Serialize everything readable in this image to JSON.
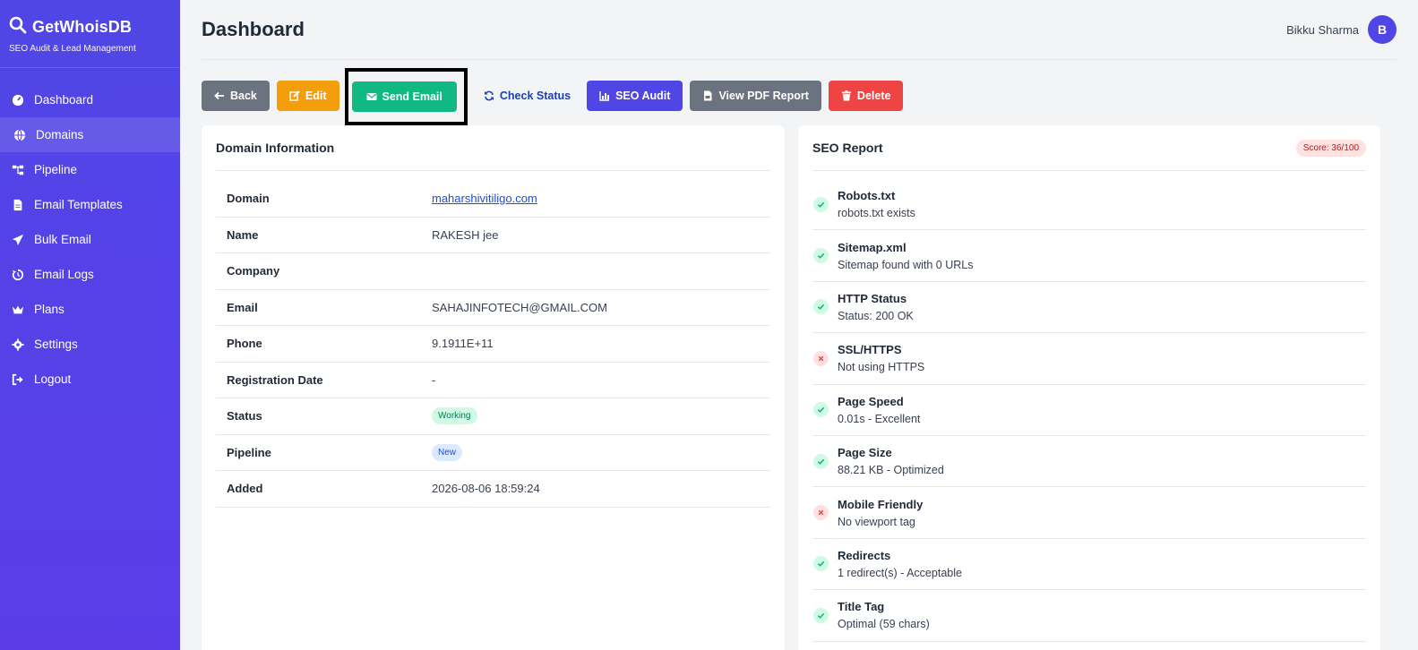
{
  "brand": {
    "name": "GetWhoisDB",
    "subtitle": "SEO Audit & Lead Management"
  },
  "sidebar": {
    "items": [
      {
        "label": "Dashboard",
        "icon": "dashboard-icon"
      },
      {
        "label": "Domains",
        "icon": "globe-icon",
        "active": true
      },
      {
        "label": "Pipeline",
        "icon": "sitemap-icon"
      },
      {
        "label": "Email Templates",
        "icon": "file-icon"
      },
      {
        "label": "Bulk Email",
        "icon": "paper-plane-icon"
      },
      {
        "label": "Email Logs",
        "icon": "history-icon"
      },
      {
        "label": "Plans",
        "icon": "crown-icon"
      },
      {
        "label": "Settings",
        "icon": "gear-icon"
      },
      {
        "label": "Logout",
        "icon": "logout-icon"
      }
    ]
  },
  "header": {
    "title": "Dashboard",
    "user_name": "Bikku Sharma",
    "avatar_initial": "B"
  },
  "toolbar": {
    "back": "Back",
    "edit": "Edit",
    "send_email": "Send Email",
    "check_status": "Check Status",
    "seo_audit": "SEO Audit",
    "view_pdf": "View PDF Report",
    "delete": "Delete"
  },
  "domain_info": {
    "title": "Domain Information",
    "rows": [
      {
        "label": "Domain",
        "value": "maharshivitiligo.com"
      },
      {
        "label": "Name",
        "value": "RAKESH jee"
      },
      {
        "label": "Company",
        "value": ""
      },
      {
        "label": "Email",
        "value": "SAHAJINFOTECH@GMAIL.COM"
      },
      {
        "label": "Phone",
        "value": "9.1911E+11"
      },
      {
        "label": "Registration Date",
        "value": "-"
      },
      {
        "label": "Status",
        "value": "Working"
      },
      {
        "label": "Pipeline",
        "value": "New"
      },
      {
        "label": "Added",
        "value": "2026-08-06 18:59:24"
      }
    ]
  },
  "seo_report": {
    "title": "SEO Report",
    "score": "Score: 36/100",
    "items": [
      {
        "title": "Robots.txt",
        "desc": "robots.txt exists",
        "status": "ok"
      },
      {
        "title": "Sitemap.xml",
        "desc": "Sitemap found with 0 URLs",
        "status": "ok"
      },
      {
        "title": "HTTP Status",
        "desc": "Status: 200 OK",
        "status": "ok"
      },
      {
        "title": "SSL/HTTPS",
        "desc": "Not using HTTPS",
        "status": "fail"
      },
      {
        "title": "Page Speed",
        "desc": "0.01s - Excellent",
        "status": "ok"
      },
      {
        "title": "Page Size",
        "desc": "88.21 KB - Optimized",
        "status": "ok"
      },
      {
        "title": "Mobile Friendly",
        "desc": "No viewport tag",
        "status": "fail"
      },
      {
        "title": "Redirects",
        "desc": "1 redirect(s) - Acceptable",
        "status": "ok"
      },
      {
        "title": "Title Tag",
        "desc": "Optimal (59 chars)",
        "status": "ok"
      }
    ]
  },
  "colors": {
    "sidebar": "#4f46e5",
    "back": "#6b7280",
    "edit": "#f59e0b",
    "send": "#10b981",
    "seo_audit": "#4f46e5",
    "delete": "#ef4444"
  }
}
